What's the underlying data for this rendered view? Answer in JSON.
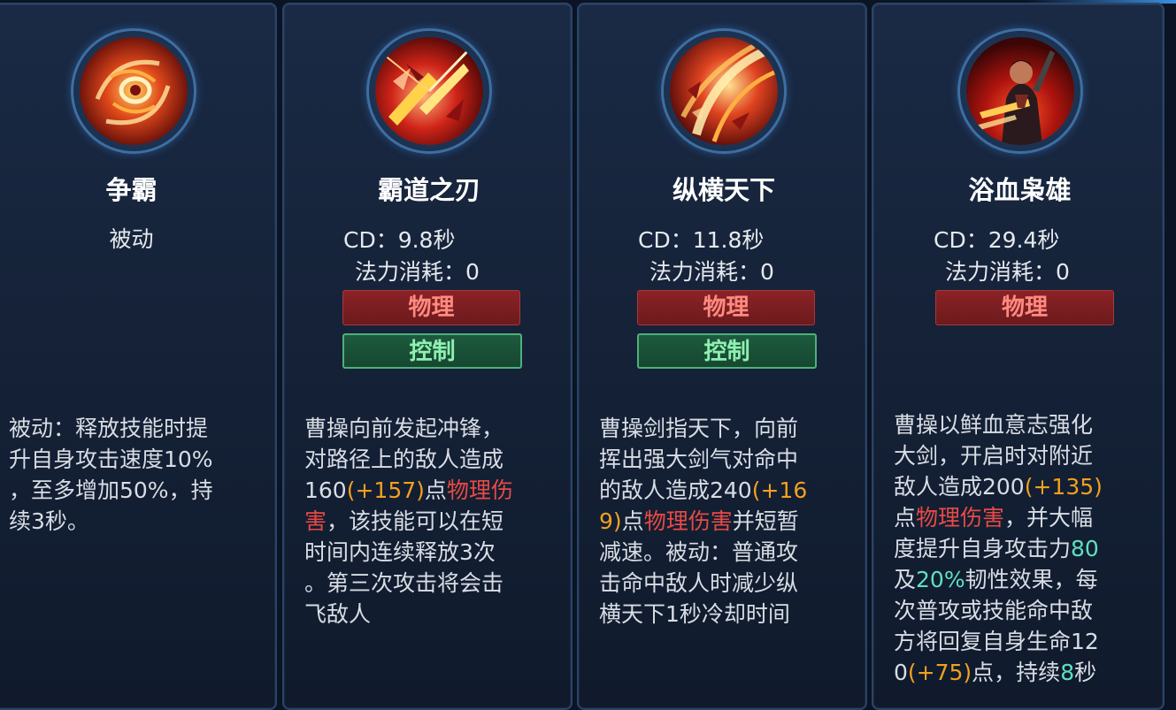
{
  "skills": [
    {
      "name": "争霸",
      "type_label": "被动",
      "icon": "swirl-passive-icon",
      "desc_lines": [
        "被动：释放技能时提",
        "升自身攻击速度10%",
        "，至多增加50%，持",
        "续3秒。"
      ]
    },
    {
      "name": "霸道之刃",
      "cd": "CD：9.8秒",
      "cost": "法力消耗：0",
      "tags": [
        "物理",
        "控制"
      ],
      "icon": "blade-dash-icon",
      "desc": {
        "l1": "曹操向前发起冲锋，",
        "l2": "对路径上的敌人造成",
        "l3a": "160",
        "l3b": "(+157)",
        "l3c": "点",
        "l3d": "物理伤",
        "l4a": "害",
        "l4b": "，该技能可以在短",
        "l5": "时间内连续释放3次",
        "l6": "。第三次攻击将会击",
        "l7": "飞敌人"
      }
    },
    {
      "name": "纵横天下",
      "cd": "CD：11.8秒",
      "cost": "法力消耗：0",
      "tags": [
        "物理",
        "控制"
      ],
      "icon": "sword-wave-icon",
      "desc": {
        "l1": "曹操剑指天下，向前",
        "l2": "挥出强大剑气对命中",
        "l3a": "的敌人造成240",
        "l3b": "(+16",
        "l4a": "9)",
        "l4b": "点",
        "l4c": "物理伤害",
        "l4d": "并短暂",
        "l5": "减速。被动：普通攻",
        "l6": "击命中敌人时减少纵",
        "l7": "横天下1秒冷却时间"
      }
    },
    {
      "name": "浴血枭雄",
      "cd": "CD：29.4秒",
      "cost": "法力消耗：0",
      "tags": [
        "物理"
      ],
      "icon": "warrior-portrait-icon",
      "desc": {
        "l1": "曹操以鲜血意志强化",
        "l2": "大剑，开启时对附近",
        "l3a": "敌人造成200",
        "l3b": "(+135)",
        "l4a": "点",
        "l4b": "物理伤害",
        "l4c": "，并大幅",
        "l5a": "度提升自身攻击力",
        "l5b": "80",
        "l6a": "及",
        "l6b": "20%",
        "l6c": "韧性效果，每",
        "l7": "次普攻或技能命中敌",
        "l8": "方将回复自身生命12",
        "l9a": "0",
        "l9b": "(+75)",
        "l9c": "点，持续",
        "l9d": "8",
        "l9e": "秒"
      }
    }
  ]
}
